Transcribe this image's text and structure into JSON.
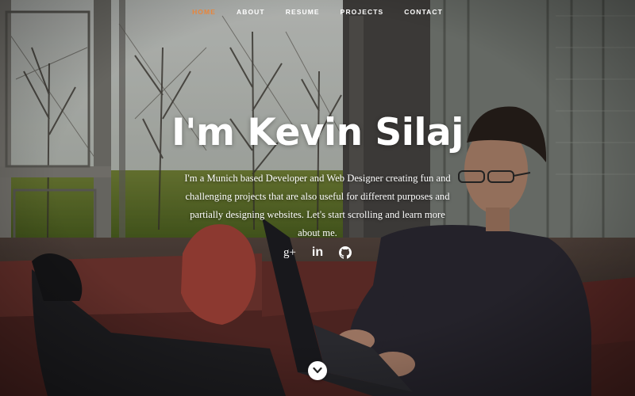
{
  "nav": {
    "items": [
      {
        "label": "Home",
        "active": true
      },
      {
        "label": "About",
        "active": false
      },
      {
        "label": "Resume",
        "active": false
      },
      {
        "label": "Projects",
        "active": false
      },
      {
        "label": "Contact",
        "active": false
      }
    ],
    "accent_color": "#e8863c"
  },
  "hero": {
    "title": "I'm Kevin Silaj",
    "bio": "I'm a Munich based Developer and Web Designer creating fun and challenging projects that are also useful for different purposes and partially designing websites. Let's start scrolling and learn more about me."
  },
  "social": [
    {
      "icon": "google-plus-icon",
      "glyph": "g+"
    },
    {
      "icon": "linkedin-icon",
      "glyph": "in"
    },
    {
      "icon": "github-icon",
      "glyph": ""
    }
  ],
  "scroll_button": {
    "icon": "chevron-down-icon"
  }
}
